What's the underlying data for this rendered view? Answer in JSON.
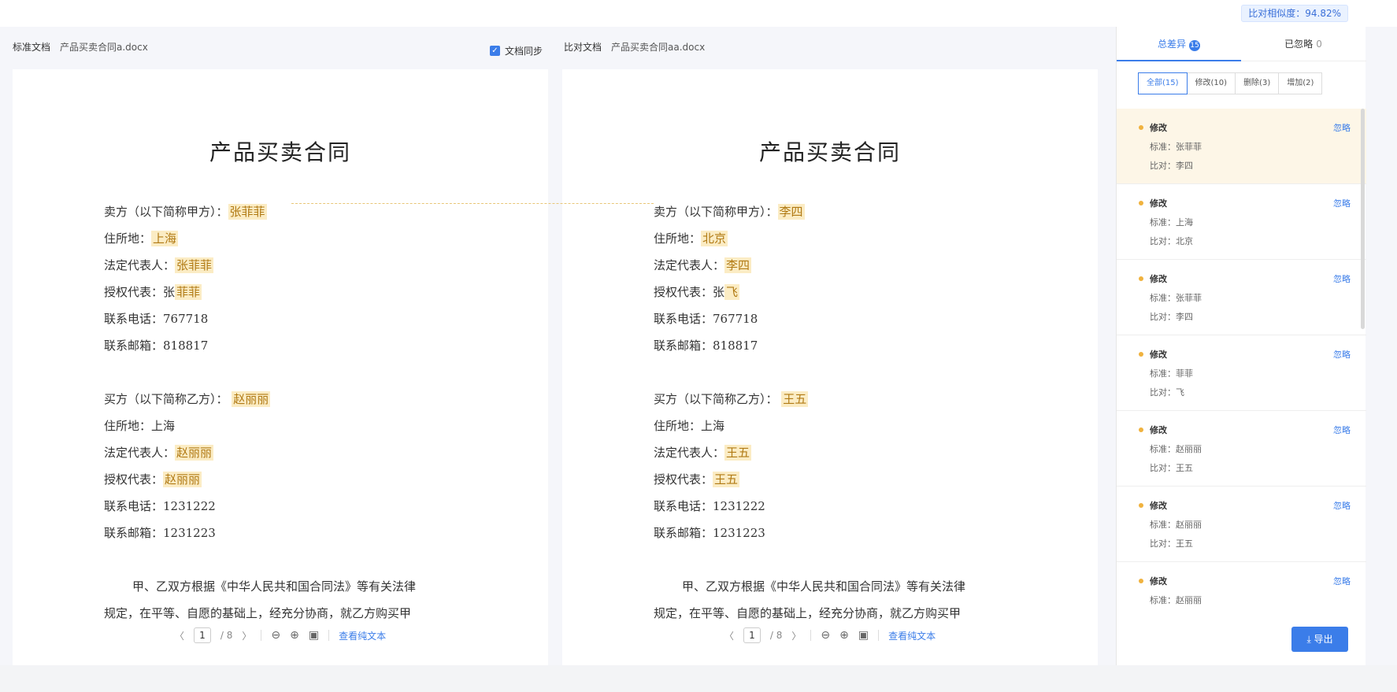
{
  "similarity": "比对相似度：94.82%",
  "sync_label": "文档同步",
  "standard": {
    "label": "标准文档",
    "file": "产品买卖合同a.docx",
    "title": "产品买卖合同",
    "seller_label": "卖方（以下简称甲方）：",
    "seller": "张菲菲",
    "address_label": "住所地：",
    "address": "上海",
    "legal_label": "法定代表人：",
    "legal": "张菲菲",
    "auth_label": "授权代表：",
    "auth_prefix": "张",
    "auth": "菲菲",
    "phone": "联系电话：767718",
    "email": "联系邮箱：818817",
    "buyer_label": "买方（以下简称乙方）：",
    "buyer": "赵丽丽",
    "buyer_address": "住所地：上海",
    "buyer_legal_label": "法定代表人：",
    "buyer_legal": "赵丽丽",
    "buyer_auth_label": "授权代表：",
    "buyer_auth": "赵丽丽",
    "buyer_phone": "联系电话：1231222",
    "buyer_email": "联系邮箱：1231223",
    "para1": "甲、乙双方根据《中华人民共和国合同法》等有关法律",
    "para2": "规定，在平等、自愿的基础上，经充分协商，就乙方购买甲"
  },
  "compare": {
    "label": "比对文档",
    "file": "产品买卖合同aa.docx",
    "title": "产品买卖合同",
    "seller_label": "卖方（以下简称甲方）：",
    "seller": "李四",
    "address_label": "住所地：",
    "address": "北京",
    "legal_label": "法定代表人：",
    "legal": "李四",
    "auth_label": "授权代表：",
    "auth_prefix": "张",
    "auth": "飞",
    "phone": "联系电话：767718",
    "email": "联系邮箱：818817",
    "buyer_label": "买方（以下简称乙方）：",
    "buyer": "王五",
    "buyer_address": "住所地：上海",
    "buyer_legal_label": "法定代表人：",
    "buyer_legal": "王五",
    "buyer_auth_label": "授权代表：",
    "buyer_auth": "王五",
    "buyer_phone": "联系电话：1231222",
    "buyer_email": "联系邮箱：1231223",
    "para1": "甲、乙双方根据《中华人民共和国合同法》等有关法律",
    "para2": "规定，在平等、自愿的基础上，经充分协商，就乙方购买甲"
  },
  "pager": {
    "current": "1",
    "total": "/ 8",
    "prev": "〈",
    "next": "〉",
    "view_text": "查看纯文本"
  },
  "sidebar": {
    "tab_diff": "总差异",
    "tab_diff_count": "15",
    "tab_ignored": "已忽略",
    "tab_ignored_count": "0",
    "filters": [
      "全部(15)",
      "修改(10)",
      "删除(3)",
      "增加(2)"
    ],
    "ignore_label": "忽略",
    "std_prefix": "标准：",
    "cmp_prefix": "比对：",
    "items": [
      {
        "type": "修改",
        "std": "张菲菲",
        "cmp": "李四"
      },
      {
        "type": "修改",
        "std": "上海",
        "cmp": "北京"
      },
      {
        "type": "修改",
        "std": "张菲菲",
        "cmp": "李四"
      },
      {
        "type": "修改",
        "std": "菲菲",
        "cmp": "飞"
      },
      {
        "type": "修改",
        "std": "赵丽丽",
        "cmp": "王五"
      },
      {
        "type": "修改",
        "std": "赵丽丽",
        "cmp": "王五"
      },
      {
        "type": "修改",
        "std": "赵丽丽",
        "cmp": ""
      }
    ],
    "export_label": "⤓ 导出"
  }
}
